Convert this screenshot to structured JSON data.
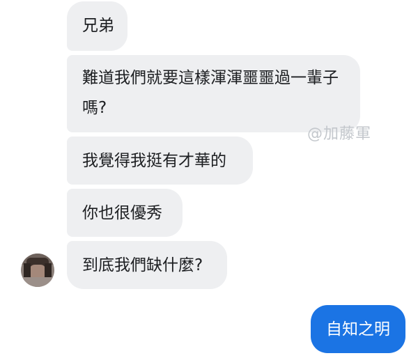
{
  "conversation": {
    "incoming_messages": [
      "兄弟",
      "難道我們就要這樣渾渾噩噩過一輩子嗎?",
      "我覺得我挺有才華的",
      "你也很優秀",
      "到底我們缺什麼?"
    ],
    "outgoing_message": "自知之明",
    "watermark": "@加藤軍"
  },
  "colors": {
    "incoming_bubble": "#eeeff1",
    "outgoing_bubble": "#1b74e4",
    "watermark": "#c3c7cc"
  }
}
